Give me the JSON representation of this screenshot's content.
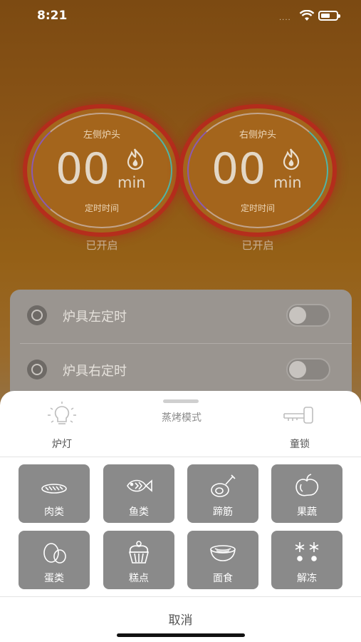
{
  "status_bar": {
    "time": "8:21",
    "signal": "....",
    "wifi_icon": "wifi-icon",
    "battery_icon": "battery-icon"
  },
  "burners": [
    {
      "title": "左侧炉头",
      "time_value": "00",
      "unit": "min",
      "subtitle": "定时时间",
      "status": "已开启",
      "icon": "flame-icon"
    },
    {
      "title": "右侧炉头",
      "time_value": "00",
      "unit": "min",
      "subtitle": "定时时间",
      "status": "已开启",
      "icon": "flame-icon"
    }
  ],
  "timers": [
    {
      "label": "炉具左定时",
      "icon": "clock-icon",
      "enabled": false
    },
    {
      "label": "炉具右定时",
      "icon": "clock-icon",
      "enabled": false
    }
  ],
  "sheet": {
    "lamp_label": "炉灯",
    "lamp_icon": "lightbulb-icon",
    "mode_title": "蒸烤模式",
    "lock_label": "童锁",
    "lock_icon": "key-icon",
    "modes": [
      {
        "label": "肉类",
        "icon": "meat-icon"
      },
      {
        "label": "鱼类",
        "icon": "fish-icon"
      },
      {
        "label": "蹄筋",
        "icon": "ham-icon"
      },
      {
        "label": "果蔬",
        "icon": "vegetable-icon"
      },
      {
        "label": "蛋类",
        "icon": "egg-icon"
      },
      {
        "label": "糕点",
        "icon": "cupcake-icon"
      },
      {
        "label": "面食",
        "icon": "noodle-bowl-icon"
      },
      {
        "label": "解冻",
        "icon": "snowflake-icon"
      }
    ],
    "cancel_label": "取消"
  },
  "colors": {
    "background_top": "#7c4a12",
    "burner_ring_glow": "#be261e",
    "tile_gray": "#8a8a8a",
    "sheet_bg": "#ffffff"
  }
}
